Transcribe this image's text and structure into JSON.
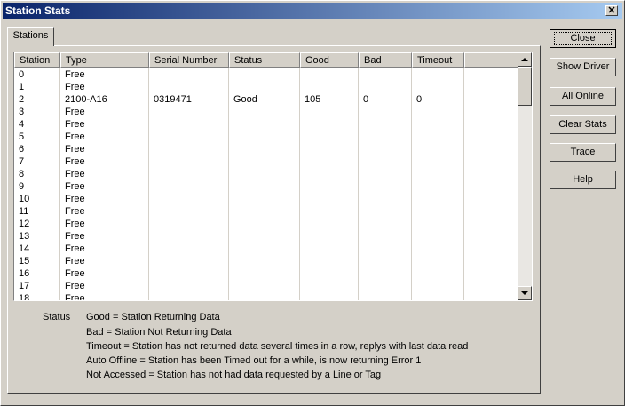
{
  "window": {
    "title": "Station Stats",
    "close_glyph": "✕"
  },
  "tabs": [
    {
      "label": "Stations",
      "active": true
    }
  ],
  "table": {
    "columns": [
      "Station",
      "Type",
      "Serial Number",
      "Status",
      "Good",
      "Bad",
      "Timeout"
    ],
    "rows": [
      [
        "0",
        "Free",
        "",
        "",
        "",
        "",
        ""
      ],
      [
        "1",
        "Free",
        "",
        "",
        "",
        "",
        ""
      ],
      [
        "2",
        "2100-A16",
        "0319471",
        "Good",
        "105",
        "0",
        "0"
      ],
      [
        "3",
        "Free",
        "",
        "",
        "",
        "",
        ""
      ],
      [
        "4",
        "Free",
        "",
        "",
        "",
        "",
        ""
      ],
      [
        "5",
        "Free",
        "",
        "",
        "",
        "",
        ""
      ],
      [
        "6",
        "Free",
        "",
        "",
        "",
        "",
        ""
      ],
      [
        "7",
        "Free",
        "",
        "",
        "",
        "",
        ""
      ],
      [
        "8",
        "Free",
        "",
        "",
        "",
        "",
        ""
      ],
      [
        "9",
        "Free",
        "",
        "",
        "",
        "",
        ""
      ],
      [
        "10",
        "Free",
        "",
        "",
        "",
        "",
        ""
      ],
      [
        "11",
        "Free",
        "",
        "",
        "",
        "",
        ""
      ],
      [
        "12",
        "Free",
        "",
        "",
        "",
        "",
        ""
      ],
      [
        "13",
        "Free",
        "",
        "",
        "",
        "",
        ""
      ],
      [
        "14",
        "Free",
        "",
        "",
        "",
        "",
        ""
      ],
      [
        "15",
        "Free",
        "",
        "",
        "",
        "",
        ""
      ],
      [
        "16",
        "Free",
        "",
        "",
        "",
        "",
        ""
      ],
      [
        "17",
        "Free",
        "",
        "",
        "",
        "",
        ""
      ],
      [
        "18",
        "Free",
        "",
        "",
        "",
        "",
        ""
      ]
    ]
  },
  "scrollbar": {
    "up_icon": "▲",
    "down_icon": "▼"
  },
  "legend": {
    "heading": "Status",
    "lines": [
      "Good = Station Returning Data",
      "Bad = Station Not Returning Data",
      "Timeout = Station has not returned data several times in a row, replys with last data read",
      "Auto Offline = Station has been Timed out for a while, is now returning Error 1",
      "Not Accessed = Station has not had data requested by a Line or Tag"
    ]
  },
  "buttons": {
    "close": "Close",
    "show_driver": "Show Driver",
    "all_online": "All Online",
    "clear_stats": "Clear Stats",
    "trace": "Trace",
    "help": "Help"
  },
  "colors": {
    "title_start": "#0a246a",
    "title_end": "#a6caf0",
    "face": "#d4d0c8"
  }
}
